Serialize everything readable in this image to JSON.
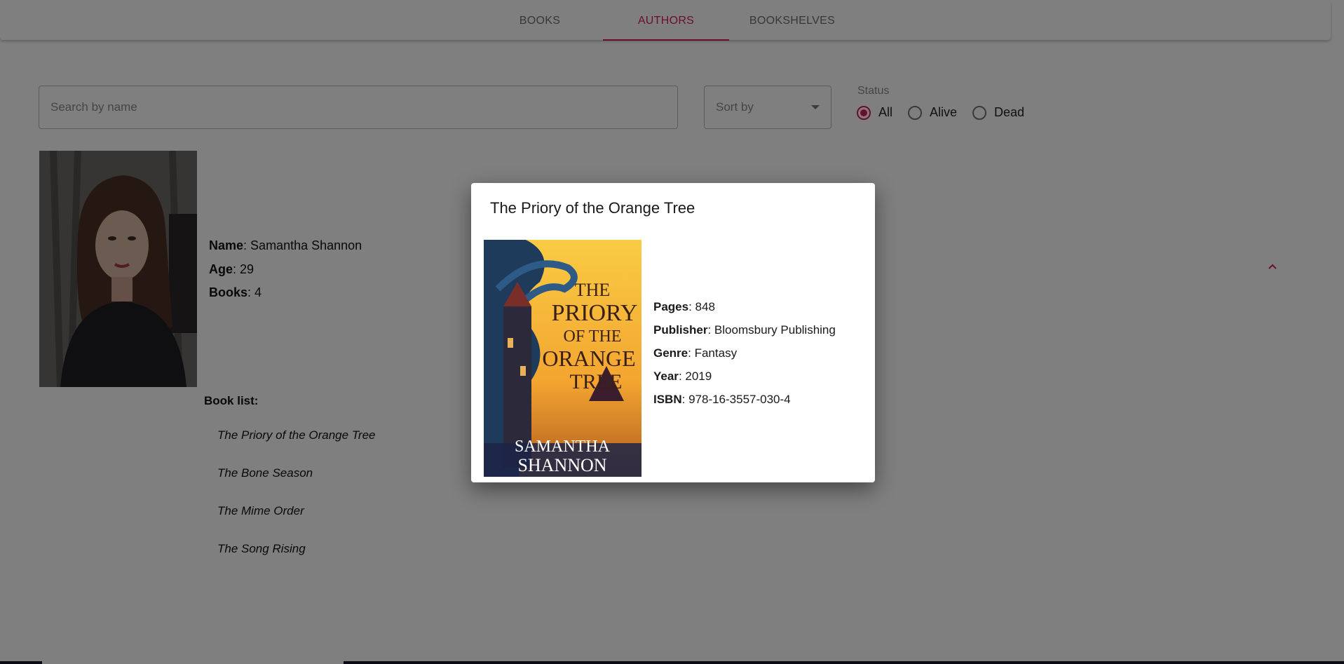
{
  "tabs": [
    {
      "label": "BOOKS"
    },
    {
      "label": "AUTHORS"
    },
    {
      "label": "BOOKSHELVES"
    }
  ],
  "active_tab": "AUTHORS",
  "search": {
    "placeholder": "Search by name",
    "value": ""
  },
  "sort": {
    "label": "Sort by"
  },
  "status": {
    "label": "Status",
    "options": [
      {
        "label": "All",
        "selected": true
      },
      {
        "label": "Alive",
        "selected": false
      },
      {
        "label": "Dead",
        "selected": false
      }
    ]
  },
  "author": {
    "name_label": "Name",
    "name": "Samantha Shannon",
    "age_label": "Age",
    "age": "29",
    "books_label": "Books",
    "books": "4",
    "booklist_title": "Book list:",
    "booklist": [
      "The Priory of the Orange Tree",
      "The Bone Season",
      "The Mime Order",
      "The Song Rising"
    ]
  },
  "dialog": {
    "title": "The Priory of the Orange Tree",
    "pages_label": "Pages",
    "pages": "848",
    "publisher_label": "Publisher",
    "publisher": "Bloomsbury Publishing",
    "genre_label": "Genre",
    "genre": "Fantasy",
    "year_label": "Year",
    "year": "2019",
    "isbn_label": "ISBN",
    "isbn": "978-16-3557-030-4",
    "cover": {
      "title_lines": [
        "THE",
        "PRIORY",
        "OF THE",
        "ORANGE",
        "TREE"
      ],
      "author_lines": [
        "SAMANTHA",
        "SHANNON"
      ]
    }
  },
  "colors": {
    "accent": "#d81b60",
    "overlay": "rgba(0,0,0,0.5)"
  },
  "icons": [
    "caret-down-icon",
    "chevron-up-icon"
  ]
}
